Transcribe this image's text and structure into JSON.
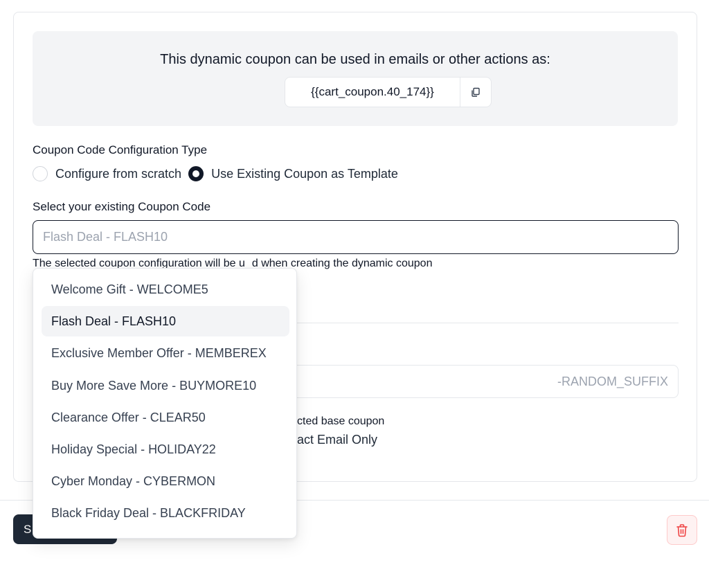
{
  "info": {
    "title": "This dynamic coupon can be used in emails or other actions as:",
    "token": "{{cart_coupon.40_174}}",
    "copy_icon": "copy-icon"
  },
  "config_type": {
    "label": "Coupon Code Configuration Type",
    "options": [
      {
        "label": "Configure from scratch",
        "checked": false
      },
      {
        "label": "Use Existing Coupon as Template",
        "checked": true
      }
    ]
  },
  "existing_coupon": {
    "label": "Select your existing Coupon Code",
    "selected": "Flash Deal - FLASH10",
    "helper_visible_start": "The selected coupon configuration will be u",
    "helper_visible_end": "d when creating the dynamic coupon"
  },
  "suffix": {
    "placeholder": "-RANDOM_SUFFIX"
  },
  "partially_hidden": {
    "line1": "cted base coupon",
    "line2": "act Email Only"
  },
  "dropdown": {
    "options": [
      "Welcome Gift - WELCOME5",
      "Flash Deal - FLASH10",
      "Exclusive Member Offer - MEMBEREX",
      "Buy More Save More - BUYMORE10",
      "Clearance Offer - CLEAR50",
      "Holiday Special - HOLIDAY22",
      "Cyber Monday - CYBERMON",
      "Black Friday Deal - BLACKFRIDAY"
    ],
    "highlighted_index": 1
  },
  "footer": {
    "save_label": "S",
    "delete_icon": "trash-icon"
  },
  "colors": {
    "primary": "#1f2937",
    "danger": "#ef4444",
    "muted": "#9ca3af"
  }
}
